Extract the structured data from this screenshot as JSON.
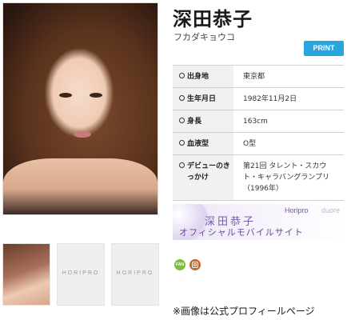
{
  "profile": {
    "name": "深田恭子",
    "kana": "フカダキョウコ",
    "print_label": "PRINT",
    "rows": [
      {
        "key": "出身地",
        "value": "東京都"
      },
      {
        "key": "生年月日",
        "value": "1982年11月2日"
      },
      {
        "key": "身長",
        "value": "163cm"
      },
      {
        "key": "血液型",
        "value": "O型"
      },
      {
        "key": "デビューのきっかけ",
        "value": "第21回 タレント・スカウト・キャラバングランプリ（1996年）"
      }
    ]
  },
  "gallery": {
    "thumb_logo": "HORIPRO"
  },
  "banner": {
    "horipro": "Horipro",
    "duore": "duore",
    "name": "深田恭子",
    "subtitle": "オフィシャルモバイルサイト"
  },
  "social": {
    "fan_label": "FAN",
    "icons": [
      "fan-club-icon",
      "instagram-icon"
    ]
  },
  "caption": "※画像は公式プロフィールページ",
  "colors": {
    "print_button": "#27a6e1",
    "fan_icon": "#7fbf3f",
    "instagram_icon": "#c26a2b",
    "banner_text": "#7a5aa8"
  }
}
